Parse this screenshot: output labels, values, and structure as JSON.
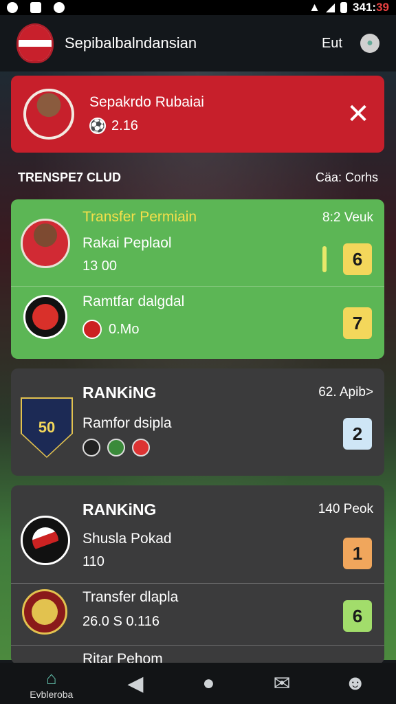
{
  "status_bar": {
    "time_prefix": "341:",
    "time_suffix": "39",
    "icons": [
      "notification-icon",
      "image-icon",
      "sync-icon",
      "wifi-icon",
      "signal-icon",
      "battery-icon"
    ]
  },
  "app_bar": {
    "title": "Sepibalbalndansian",
    "action_label": "Eut",
    "icons": [
      "club-logo-icon",
      "profile-icon"
    ]
  },
  "promo": {
    "title": "Sepakrdo Rubaiai",
    "subtitle": "2.16",
    "close_icon": "close-icon"
  },
  "section": {
    "left": "TRENSPE7 CLUD",
    "right": "Cäa: Corhs"
  },
  "transfer_card": {
    "title": "Transfer Permiain",
    "right_label": "8:2 Veuk",
    "rows": [
      {
        "name": "Rakai Peplaol",
        "sub": "13 00",
        "score": "6"
      },
      {
        "name": "Ramtfar dalgdal",
        "sub": "0.Mo",
        "score": "7"
      }
    ]
  },
  "ranking_1": {
    "title": "RANKiNG",
    "right_label": "62. Apib>",
    "name": "Ramfor dsipla",
    "score": "2",
    "badge_text": "50"
  },
  "ranking_2": {
    "title": "RANKiNG",
    "right_label": "140 Peok",
    "rows": [
      {
        "name": "Shusla Pokad",
        "sub": "110",
        "score": "1"
      },
      {
        "name": "Transfer dlapla",
        "sub": "26.0 S 0.116",
        "score": "6"
      },
      {
        "name": "Ritar Pehom",
        "sub": "",
        "score": ""
      }
    ]
  },
  "bottom_nav": {
    "items": [
      {
        "label": "Evbleroba",
        "icon": "home-icon"
      },
      {
        "label": "",
        "icon": "back-icon"
      },
      {
        "label": "",
        "icon": "circle-home-icon"
      },
      {
        "label": "",
        "icon": "chat-icon"
      },
      {
        "label": "",
        "icon": "user-icon"
      }
    ]
  }
}
